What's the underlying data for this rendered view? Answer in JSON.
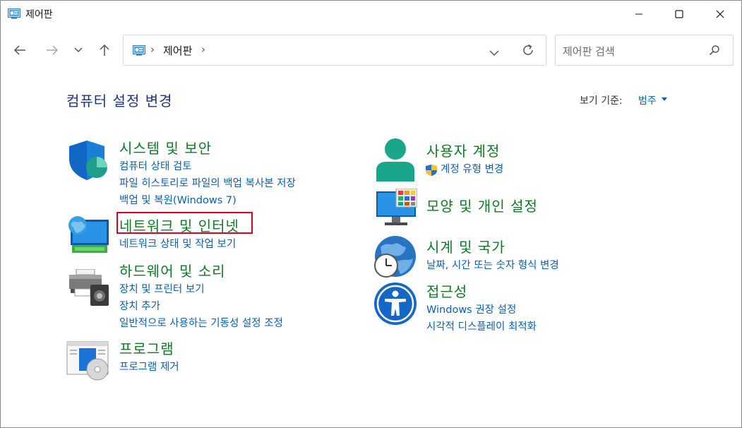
{
  "window": {
    "title": "제어판"
  },
  "address": {
    "breadcrumb": "제어판",
    "separator": "›"
  },
  "search": {
    "placeholder": "제어판 검색"
  },
  "main": {
    "heading": "컴퓨터 설정 변경",
    "view_by_label": "보기 기준:",
    "view_by_value": "범주"
  },
  "categories": {
    "system": {
      "title": "시스템 및 보안",
      "links": [
        "컴퓨터 상태 검토",
        "파일 히스토리로 파일의 백업 복사본 저장",
        "백업 및 복원(Windows 7)"
      ]
    },
    "network": {
      "title": "네트워크 및 인터넷",
      "links": [
        "네트워크 상태 및 작업 보기"
      ]
    },
    "hardware": {
      "title": "하드웨어 및 소리",
      "links": [
        "장치 및 프린터 보기",
        "장치 추가",
        "일반적으로 사용하는 기동성 설정 조정"
      ]
    },
    "programs": {
      "title": "프로그램",
      "links": [
        "프로그램 제거"
      ]
    },
    "users": {
      "title": "사용자 계정",
      "links": [
        "계정 유형 변경"
      ]
    },
    "appearance": {
      "title": "모양 및 개인 설정",
      "links": []
    },
    "clock": {
      "title": "시계 및 국가",
      "links": [
        "날짜, 시간 또는 숫자 형식 변경"
      ]
    },
    "access": {
      "title": "접근성",
      "links": [
        "Windows 권장 설정",
        "시각적 디스플레이 최적화"
      ]
    }
  },
  "icons": {
    "title": "control-panel-icon",
    "back": "arrow-left-icon",
    "forward": "arrow-right-icon",
    "recent": "chevron-down-icon",
    "up": "arrow-up-icon",
    "refresh": "refresh-icon",
    "search": "search-icon"
  },
  "colors": {
    "heading": "#1e3287",
    "category": "#0e7a25",
    "link": "#0a5fb4",
    "highlight": "#e0001a"
  }
}
